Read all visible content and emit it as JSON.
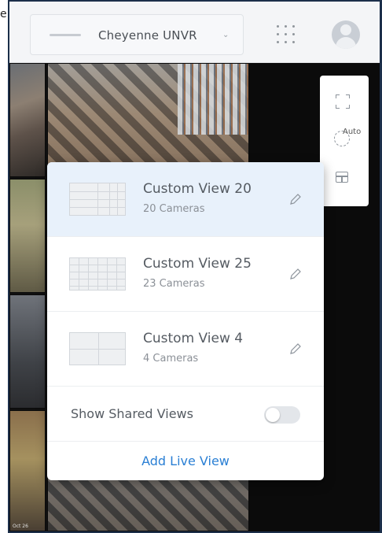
{
  "corner": {
    "text": "e"
  },
  "header": {
    "console_name": "Cheyenne UNVR",
    "chevron": "⌄",
    "icons": [
      "app-grid-icon",
      "avatar-icon"
    ]
  },
  "cameras": {
    "timestamps": [
      "",
      "",
      "",
      "",
      "Oct 26",
      ""
    ]
  },
  "tools": {
    "auto_label": "Auto",
    "icons": [
      "fullscreen-icon",
      "quality-icon",
      "layout-icon"
    ]
  },
  "views_menu": {
    "views": [
      {
        "name": "Custom View 20",
        "count": "20 Cameras",
        "selected": true
      },
      {
        "name": "Custom View 25",
        "count": "23 Cameras",
        "selected": false
      },
      {
        "name": "Custom View 4",
        "count": "4 Cameras",
        "selected": false
      }
    ],
    "shared_label": "Show Shared Views",
    "shared_enabled": false,
    "add_label": "Add Live View",
    "accent_color": "#2a7fd4",
    "selected_bg": "#e8f1fb"
  }
}
